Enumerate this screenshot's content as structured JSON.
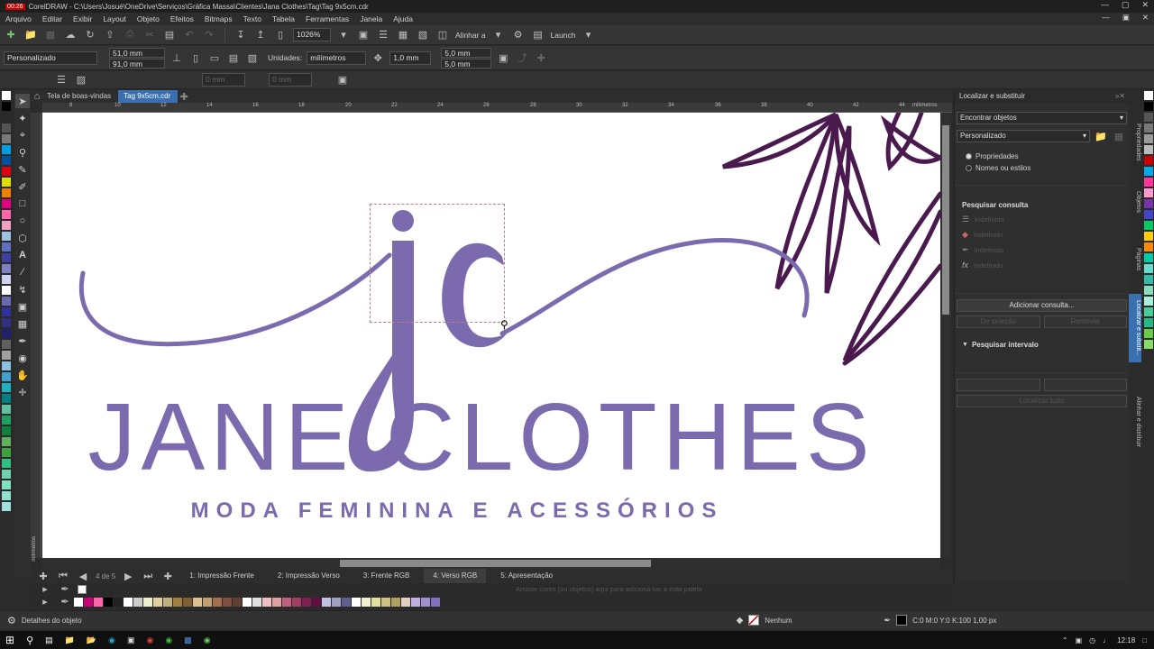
{
  "window": {
    "title": "CorelDRAW - C:\\Users\\Josué\\OneDrive\\Serviços\\Gráfica Massa\\Clientes\\Jana Clothes\\Tag\\Tag 9x5cm.cdr",
    "badge": "00:26"
  },
  "menu": [
    "Arquivo",
    "Editar",
    "Exibir",
    "Layout",
    "Objeto",
    "Efeitos",
    "Bitmaps",
    "Texto",
    "Tabela",
    "Ferramentas",
    "Janela",
    "Ajuda"
  ],
  "toolbar1": {
    "zoom": "1026%",
    "align_label": "Alinhar a",
    "launch_label": "Launch"
  },
  "toolbar2": {
    "preset": "Personalizado",
    "width": "51,0 mm",
    "height": "91,0 mm",
    "units_label": "Unidades:",
    "units_value": "milímetros",
    "nudge": "1,0 mm",
    "dup_x": "5,0 mm",
    "dup_y": "5,0 mm"
  },
  "toolbar3": {
    "field1": "0 mm",
    "field2": "0 mm"
  },
  "doc_tabs": [
    {
      "label": "Tela de boas-vindas",
      "active": false
    },
    {
      "label": "Tag 9x5cm.cdr",
      "active": true
    }
  ],
  "ruler": {
    "h_numbers": [
      "8",
      "10",
      "12",
      "14",
      "16",
      "18",
      "20",
      "22",
      "24",
      "26",
      "28",
      "30",
      "32",
      "34",
      "36",
      "38",
      "40",
      "42",
      "44"
    ],
    "h_unit": "milímetros",
    "v_unit": "milímetros"
  },
  "artwork": {
    "monogram": "jc",
    "brand": "JANE CLOTHES",
    "tagline": "MODA FEMININA E ACESSÓRIOS",
    "logo_color": "#7b6aae",
    "leaf_color": "#4a1a4f"
  },
  "pages": {
    "counter": "4 de 5",
    "tabs": [
      {
        "label": "1: Impressão Frente",
        "active": false
      },
      {
        "label": "2: Impressão Verso",
        "active": false
      },
      {
        "label": "3: Frente RGB",
        "active": false
      },
      {
        "label": "4: Verso RGB",
        "active": true
      },
      {
        "label": "5: Apresentação",
        "active": false
      }
    ]
  },
  "palette_hint": "Arraste cores (ou objetos) aqui para adicioná-las a esta paleta",
  "docker": {
    "title": "Localizar e substituir",
    "mode": "Encontrar objetos",
    "preset": "Personalizado",
    "radio1": "Propriedades",
    "radio2": "Nomes ou estilos",
    "query_section": "Pesquisar consulta",
    "undefined_items": [
      "Indefinido",
      "Indefinido",
      "Indefinido",
      "Indefinido"
    ],
    "add_query": "Adicionar consulta...",
    "btn_left": "De seleção",
    "btn_right": "Remover",
    "range_section": "Pesquisar intervalo",
    "find_all": "Localizar tudo"
  },
  "right_tabs": [
    "Propriedades",
    "Objetos",
    "Páginas",
    "Localizar e substit...",
    "Alinhar e distribuir"
  ],
  "status": {
    "details": "Detalhes do objeto",
    "fill": "Nenhum",
    "outline": "C:0 M:0 Y:0 K:100  1,00 px"
  },
  "taskbar": {
    "time": "12:18"
  },
  "colors": {
    "accent": "#3a6fb0",
    "canvas_bg": "#ffffff",
    "app_bg": "#2b2b2b"
  },
  "left_palette": [
    "#ffffff",
    "#000000",
    "#2a2a2a",
    "#555555",
    "#7a7a7a",
    "#00a0e0",
    "#0050a0",
    "#e00010",
    "#e0e000",
    "#f08000",
    "#e00080",
    "#ff66aa",
    "#f2a0c0",
    "#a0c0e0",
    "#6070c0",
    "#4040a0",
    "#8080c0",
    "#d0d0f0",
    "#ffffff",
    "#6a6ab0",
    "#3030a0",
    "#303080",
    "#202070",
    "#606060",
    "#a0a0a0",
    "#90c0e0",
    "#40a0d0",
    "#20b0c0",
    "#008080",
    "#60c0a0",
    "#20a060",
    "#108040",
    "#60b060",
    "#40a040",
    "#30c080",
    "#70d0b0",
    "#80e0c0",
    "#90e0d0",
    "#a0e0e0"
  ],
  "right_palette": [
    "#ffffff",
    "#000000",
    "#555555",
    "#777777",
    "#999999",
    "#bbbbbb",
    "#cc0000",
    "#00aaee",
    "#ff3399",
    "#ff99cc",
    "#7733aa",
    "#4444cc",
    "#00cc66",
    "#ffcc00",
    "#ff8800",
    "#00ccaa",
    "#66ddcc",
    "#33bbaa",
    "#88ddbb",
    "#aaeedd",
    "#44cc99",
    "#22bb88",
    "#66cc44",
    "#88dd66"
  ],
  "bottom_palette": [
    "#ffffff",
    "#cc0077",
    "#ff66aa",
    "#000000",
    "#222222",
    "#ffffff",
    "#cccccc",
    "#eeeecc",
    "#e0d0a0",
    "#c0b080",
    "#a08040",
    "#806030",
    "#e0c090",
    "#c0a070",
    "#a07050",
    "#805040",
    "#604030",
    "#ffffff",
    "#e0e0e0",
    "#f0c0c0",
    "#e0a0a0",
    "#c06080",
    "#a04060",
    "#802050",
    "#601040",
    "#c0c0e0",
    "#a0a0c0",
    "#606090",
    "#ffffff",
    "#f0f0d0",
    "#e0e0a0",
    "#d0c080",
    "#b0a060",
    "#e0d0c0",
    "#c0b0e0",
    "#a090d0",
    "#8070c0"
  ]
}
